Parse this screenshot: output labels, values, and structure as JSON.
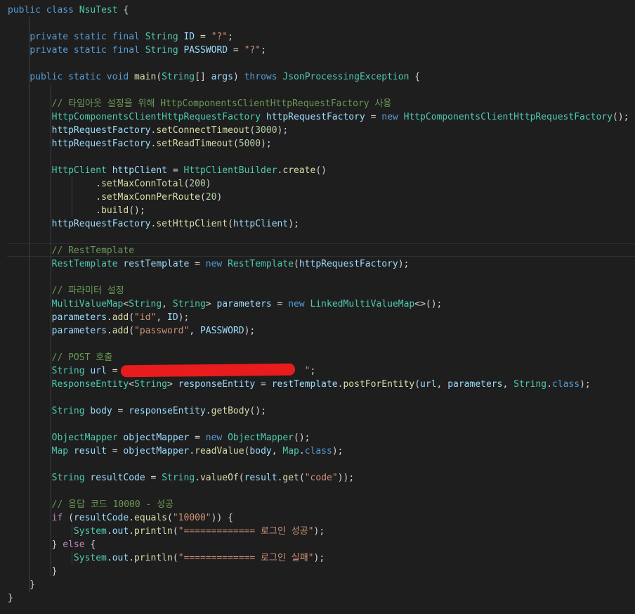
{
  "editor": {
    "background": "#1e1e1e",
    "colors": {
      "keyword": "#569cd6",
      "control": "#c586c0",
      "type": "#4ec9b0",
      "function": "#dcdcaa",
      "variable": "#9cdcfe",
      "string": "#ce9178",
      "number": "#b5cea8",
      "comment": "#6a9955",
      "plain": "#d4d4d4",
      "redaction": "#e81c1c"
    },
    "lines": [
      [
        [
          "k",
          "public class "
        ],
        [
          "t",
          "NsuTest"
        ],
        [
          "p",
          " {"
        ]
      ],
      [],
      [
        [
          "p",
          "    "
        ],
        [
          "k",
          "private static final "
        ],
        [
          "t",
          "String "
        ],
        [
          "v",
          "ID"
        ],
        [
          "p",
          " = "
        ],
        [
          "s",
          "\"?\""
        ],
        [
          "p",
          ";"
        ]
      ],
      [
        [
          "p",
          "    "
        ],
        [
          "k",
          "private static final "
        ],
        [
          "t",
          "String "
        ],
        [
          "v",
          "PASSWORD"
        ],
        [
          "p",
          " = "
        ],
        [
          "s",
          "\"?\""
        ],
        [
          "p",
          ";"
        ]
      ],
      [],
      [
        [
          "p",
          "    "
        ],
        [
          "k",
          "public static void "
        ],
        [
          "f",
          "main"
        ],
        [
          "p",
          "("
        ],
        [
          "t",
          "String"
        ],
        [
          "p",
          "[] "
        ],
        [
          "v",
          "args"
        ],
        [
          "p",
          ") "
        ],
        [
          "k",
          "throws "
        ],
        [
          "t",
          "JsonProcessingException"
        ],
        [
          "p",
          " {"
        ]
      ],
      [],
      [
        [
          "p",
          "        "
        ],
        [
          "c",
          "// 타임아웃 설정을 위해 HttpComponentsClientHttpRequestFactory 사용"
        ]
      ],
      [
        [
          "p",
          "        "
        ],
        [
          "t",
          "HttpComponentsClientHttpRequestFactory "
        ],
        [
          "v",
          "httpRequestFactory"
        ],
        [
          "p",
          " = "
        ],
        [
          "k",
          "new "
        ],
        [
          "t",
          "HttpComponentsClientHttpRequestFactory"
        ],
        [
          "p",
          "();"
        ]
      ],
      [
        [
          "p",
          "        "
        ],
        [
          "v",
          "httpRequestFactory"
        ],
        [
          "p",
          "."
        ],
        [
          "f",
          "setConnectTimeout"
        ],
        [
          "p",
          "("
        ],
        [
          "n",
          "3000"
        ],
        [
          "p",
          ");"
        ]
      ],
      [
        [
          "p",
          "        "
        ],
        [
          "v",
          "httpRequestFactory"
        ],
        [
          "p",
          "."
        ],
        [
          "f",
          "setReadTimeout"
        ],
        [
          "p",
          "("
        ],
        [
          "n",
          "5000"
        ],
        [
          "p",
          ");"
        ]
      ],
      [],
      [
        [
          "p",
          "        "
        ],
        [
          "t",
          "HttpClient "
        ],
        [
          "v",
          "httpClient"
        ],
        [
          "p",
          " = "
        ],
        [
          "t",
          "HttpClientBuilder"
        ],
        [
          "p",
          "."
        ],
        [
          "f",
          "create"
        ],
        [
          "p",
          "()"
        ]
      ],
      [
        [
          "p",
          "                ."
        ],
        [
          "f",
          "setMaxConnTotal"
        ],
        [
          "p",
          "("
        ],
        [
          "n",
          "200"
        ],
        [
          "p",
          ")"
        ]
      ],
      [
        [
          "p",
          "                ."
        ],
        [
          "f",
          "setMaxConnPerRoute"
        ],
        [
          "p",
          "("
        ],
        [
          "n",
          "20"
        ],
        [
          "p",
          ")"
        ]
      ],
      [
        [
          "p",
          "                ."
        ],
        [
          "f",
          "build"
        ],
        [
          "p",
          "();"
        ]
      ],
      [
        [
          "p",
          "        "
        ],
        [
          "v",
          "httpRequestFactory"
        ],
        [
          "p",
          "."
        ],
        [
          "f",
          "setHttpClient"
        ],
        [
          "p",
          "("
        ],
        [
          "v",
          "httpClient"
        ],
        [
          "p",
          ");"
        ]
      ],
      [],
      [
        [
          "p",
          "        "
        ],
        [
          "c",
          "// RestTemplate"
        ]
      ],
      [
        [
          "p",
          "        "
        ],
        [
          "t",
          "RestTemplate "
        ],
        [
          "v",
          "restTemplate"
        ],
        [
          "p",
          " = "
        ],
        [
          "k",
          "new "
        ],
        [
          "t",
          "RestTemplate"
        ],
        [
          "p",
          "("
        ],
        [
          "v",
          "httpRequestFactory"
        ],
        [
          "p",
          ");"
        ]
      ],
      [],
      [
        [
          "p",
          "        "
        ],
        [
          "c",
          "// 파라미터 설정"
        ]
      ],
      [
        [
          "p",
          "        "
        ],
        [
          "t",
          "MultiValueMap"
        ],
        [
          "p",
          "<"
        ],
        [
          "t",
          "String"
        ],
        [
          "p",
          ", "
        ],
        [
          "t",
          "String"
        ],
        [
          "p",
          "> "
        ],
        [
          "v",
          "parameters"
        ],
        [
          "p",
          " = "
        ],
        [
          "k",
          "new "
        ],
        [
          "t",
          "LinkedMultiValueMap"
        ],
        [
          "p",
          "<>();"
        ]
      ],
      [
        [
          "p",
          "        "
        ],
        [
          "v",
          "parameters"
        ],
        [
          "p",
          "."
        ],
        [
          "f",
          "add"
        ],
        [
          "p",
          "("
        ],
        [
          "s",
          "\"id\""
        ],
        [
          "p",
          ", "
        ],
        [
          "v",
          "ID"
        ],
        [
          "p",
          ");"
        ]
      ],
      [
        [
          "p",
          "        "
        ],
        [
          "v",
          "parameters"
        ],
        [
          "p",
          "."
        ],
        [
          "f",
          "add"
        ],
        [
          "p",
          "("
        ],
        [
          "s",
          "\"password\""
        ],
        [
          "p",
          ", "
        ],
        [
          "v",
          "PASSWORD"
        ],
        [
          "p",
          ");"
        ]
      ],
      [],
      [
        [
          "p",
          "        "
        ],
        [
          "c",
          "// POST 호출"
        ]
      ],
      [
        [
          "p",
          "        "
        ],
        [
          "t",
          "String "
        ],
        [
          "v",
          "url"
        ],
        [
          "p",
          " = "
        ],
        [
          "s",
          "\"                                \""
        ],
        [
          "p",
          ";"
        ]
      ],
      [
        [
          "p",
          "        "
        ],
        [
          "t",
          "ResponseEntity"
        ],
        [
          "p",
          "<"
        ],
        [
          "t",
          "String"
        ],
        [
          "p",
          "> "
        ],
        [
          "v",
          "responseEntity"
        ],
        [
          "p",
          " = "
        ],
        [
          "v",
          "restTemplate"
        ],
        [
          "p",
          "."
        ],
        [
          "f",
          "postForEntity"
        ],
        [
          "p",
          "("
        ],
        [
          "v",
          "url"
        ],
        [
          "p",
          ", "
        ],
        [
          "v",
          "parameters"
        ],
        [
          "p",
          ", "
        ],
        [
          "t",
          "String"
        ],
        [
          "p",
          "."
        ],
        [
          "k",
          "class"
        ],
        [
          "p",
          ");"
        ]
      ],
      [],
      [
        [
          "p",
          "        "
        ],
        [
          "t",
          "String "
        ],
        [
          "v",
          "body"
        ],
        [
          "p",
          " = "
        ],
        [
          "v",
          "responseEntity"
        ],
        [
          "p",
          "."
        ],
        [
          "f",
          "getBody"
        ],
        [
          "p",
          "();"
        ]
      ],
      [],
      [
        [
          "p",
          "        "
        ],
        [
          "t",
          "ObjectMapper "
        ],
        [
          "v",
          "objectMapper"
        ],
        [
          "p",
          " = "
        ],
        [
          "k",
          "new "
        ],
        [
          "t",
          "ObjectMapper"
        ],
        [
          "p",
          "();"
        ]
      ],
      [
        [
          "p",
          "        "
        ],
        [
          "t",
          "Map "
        ],
        [
          "v",
          "result"
        ],
        [
          "p",
          " = "
        ],
        [
          "v",
          "objectMapper"
        ],
        [
          "p",
          "."
        ],
        [
          "f",
          "readValue"
        ],
        [
          "p",
          "("
        ],
        [
          "v",
          "body"
        ],
        [
          "p",
          ", "
        ],
        [
          "t",
          "Map"
        ],
        [
          "p",
          "."
        ],
        [
          "k",
          "class"
        ],
        [
          "p",
          ");"
        ]
      ],
      [],
      [
        [
          "p",
          "        "
        ],
        [
          "t",
          "String "
        ],
        [
          "v",
          "resultCode"
        ],
        [
          "p",
          " = "
        ],
        [
          "t",
          "String"
        ],
        [
          "p",
          "."
        ],
        [
          "f",
          "valueOf"
        ],
        [
          "p",
          "("
        ],
        [
          "v",
          "result"
        ],
        [
          "p",
          "."
        ],
        [
          "f",
          "get"
        ],
        [
          "p",
          "("
        ],
        [
          "s",
          "\"code\""
        ],
        [
          "p",
          "));"
        ]
      ],
      [],
      [
        [
          "p",
          "        "
        ],
        [
          "c",
          "// 응답 코드 10000 - 성공"
        ]
      ],
      [
        [
          "p",
          "        "
        ],
        [
          "kc",
          "if "
        ],
        [
          "p",
          "("
        ],
        [
          "v",
          "resultCode"
        ],
        [
          "p",
          "."
        ],
        [
          "f",
          "equals"
        ],
        [
          "p",
          "("
        ],
        [
          "s",
          "\"10000\""
        ],
        [
          "p",
          ")) {"
        ]
      ],
      [
        [
          "p",
          "            "
        ],
        [
          "t",
          "System"
        ],
        [
          "p",
          "."
        ],
        [
          "v",
          "out"
        ],
        [
          "p",
          "."
        ],
        [
          "f",
          "println"
        ],
        [
          "p",
          "("
        ],
        [
          "s",
          "\"============= 로그인 성공\""
        ],
        [
          "p",
          ");"
        ]
      ],
      [
        [
          "p",
          "        } "
        ],
        [
          "kc",
          "else "
        ],
        [
          "p",
          "{"
        ]
      ],
      [
        [
          "p",
          "            "
        ],
        [
          "t",
          "System"
        ],
        [
          "p",
          "."
        ],
        [
          "v",
          "out"
        ],
        [
          "p",
          "."
        ],
        [
          "f",
          "println"
        ],
        [
          "p",
          "("
        ],
        [
          "s",
          "\"============= 로그인 실패\""
        ],
        [
          "p",
          ");"
        ]
      ],
      [
        [
          "p",
          "        }"
        ]
      ],
      [
        [
          "p",
          "    }"
        ]
      ],
      [
        [
          "p",
          "}"
        ]
      ]
    ]
  }
}
